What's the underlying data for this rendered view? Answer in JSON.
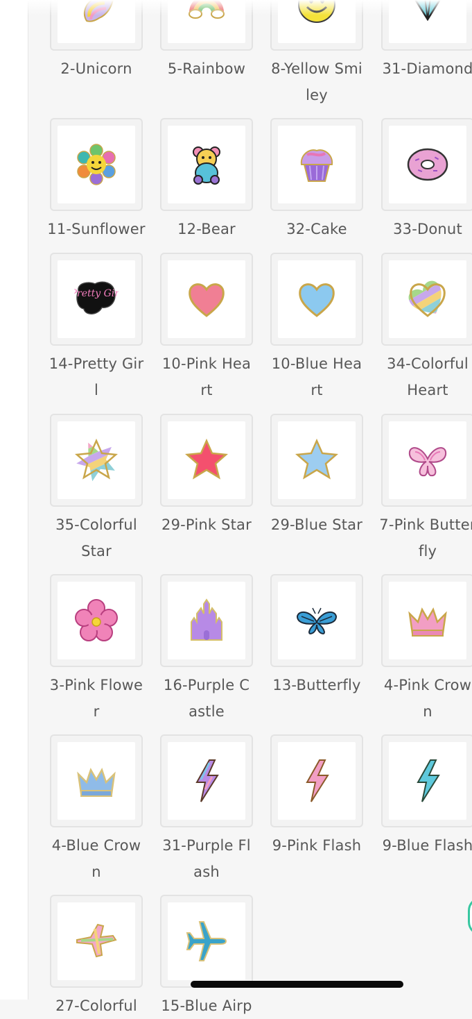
{
  "products": [
    {
      "label": [
        "2-Unicorn"
      ],
      "icon": "unicorn-patch-icon"
    },
    {
      "label": [
        "5-Rainbow"
      ],
      "icon": "rainbow-patch-icon"
    },
    {
      "label": [
        "8-Yellow Smi",
        "ley"
      ],
      "icon": "yellow-smiley-patch-icon"
    },
    {
      "label": [
        "31-Diamond"
      ],
      "icon": "diamond-patch-icon"
    },
    {
      "label": [
        "11-Sunflower"
      ],
      "icon": "sunflower-patch-icon"
    },
    {
      "label": [
        "12-Bear"
      ],
      "icon": "bear-patch-icon"
    },
    {
      "label": [
        "32-Cake"
      ],
      "icon": "cupcake-patch-icon"
    },
    {
      "label": [
        "33-Donut"
      ],
      "icon": "donut-patch-icon"
    },
    {
      "label": [
        "14-Pretty Gir",
        "l"
      ],
      "icon": "pretty-girl-patch-icon"
    },
    {
      "label": [
        "10-Pink Hea",
        "rt"
      ],
      "icon": "pink-heart-patch-icon"
    },
    {
      "label": [
        "10-Blue Hea",
        "rt"
      ],
      "icon": "blue-heart-patch-icon"
    },
    {
      "label": [
        "34-Colorful",
        "Heart"
      ],
      "icon": "colorful-heart-patch-icon"
    },
    {
      "label": [
        "35-Colorful",
        "Star"
      ],
      "icon": "colorful-star-patch-icon"
    },
    {
      "label": [
        "29-Pink Star"
      ],
      "icon": "pink-star-patch-icon"
    },
    {
      "label": [
        "29-Blue Star"
      ],
      "icon": "blue-star-patch-icon"
    },
    {
      "label": [
        "7-Pink Butter",
        "fly"
      ],
      "icon": "pink-butterfly-patch-icon"
    },
    {
      "label": [
        "3-Pink Flowe",
        "r"
      ],
      "icon": "pink-flower-patch-icon"
    },
    {
      "label": [
        "16-Purple C",
        "astle"
      ],
      "icon": "purple-castle-patch-icon"
    },
    {
      "label": [
        "13-Butterfly"
      ],
      "icon": "blue-butterfly-patch-icon"
    },
    {
      "label": [
        "4-Pink Crow",
        "n"
      ],
      "icon": "pink-crown-patch-icon"
    },
    {
      "label": [
        "4-Blue Crow",
        "n"
      ],
      "icon": "blue-crown-patch-icon"
    },
    {
      "label": [
        "31-Purple Fl",
        "ash"
      ],
      "icon": "purple-flash-patch-icon"
    },
    {
      "label": [
        "9-Pink Flash"
      ],
      "icon": "pink-flash-patch-icon"
    },
    {
      "label": [
        "9-Blue Flash"
      ],
      "icon": "blue-flash-patch-icon"
    },
    {
      "label": [
        "27-Colorful"
      ],
      "icon": "colorful-airplane-patch-icon"
    },
    {
      "label": [
        "15-Blue Airp"
      ],
      "icon": "blue-airplane-patch-icon"
    }
  ],
  "patch_text": "Pretty Girl"
}
